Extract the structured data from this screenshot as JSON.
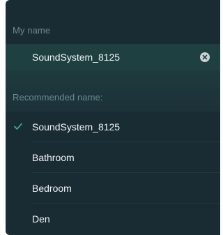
{
  "name_section": {
    "label": "My name",
    "current_value": "SoundSystem_8125"
  },
  "recommended_section": {
    "label": "Recommended name:",
    "items": [
      {
        "label": "SoundSystem_8125",
        "selected": true
      },
      {
        "label": "Bathroom",
        "selected": false
      },
      {
        "label": "Bedroom",
        "selected": false
      },
      {
        "label": "Den",
        "selected": false
      }
    ]
  },
  "icons": {
    "clear": "clear-circle-icon",
    "check": "checkmark-icon"
  },
  "colors": {
    "panel_bg": "#1a2c33",
    "field_bg": "#1f4041",
    "accent": "#2fbf8f",
    "text": "#f0f4f5",
    "muted": "#6f8791"
  }
}
